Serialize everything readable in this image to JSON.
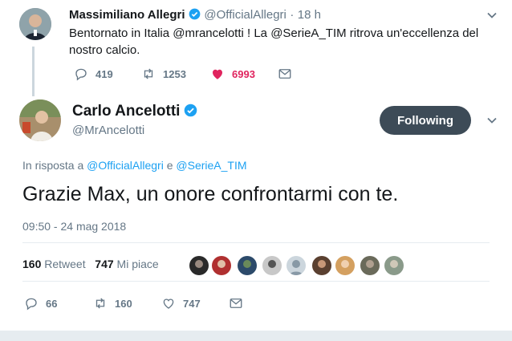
{
  "tweet_parent": {
    "author_name": "Massimiliano Allegri",
    "handle": "@OfficialAllegri",
    "separator": "·",
    "time": "18 h",
    "text_line1": "Bentornato in Italia @mrancelotti ! La @SerieA_TIM ritrova un'eccellenza del",
    "text_line2": "nostro calcio.",
    "replies": "419",
    "retweets": "1253",
    "likes": "6993",
    "like_color": "#e0245e"
  },
  "tweet_main": {
    "author_name": "Carlo Ancelotti",
    "handle": "@MrAncelotti",
    "follow_label": "Following",
    "reply_prefix": "In risposta a",
    "reply_user1": "@OfficialAllegri",
    "reply_conj": "e",
    "reply_user2": "@SerieA_TIM",
    "text": "Grazie Max, un onore confrontarmi con te.",
    "timestamp": "09:50 - 24 mag 2018",
    "retweet_count": "160",
    "retweet_label": "Retweet",
    "like_count": "747",
    "like_label": "Mi piace",
    "replies": "66",
    "retweets": "160",
    "likes": "747"
  },
  "colors": {
    "accent": "#1da1f2",
    "verified": "#1da1f2",
    "follow_button": "#3d4b57",
    "secondary_text": "#657786"
  },
  "likers_avatar_count": 9
}
